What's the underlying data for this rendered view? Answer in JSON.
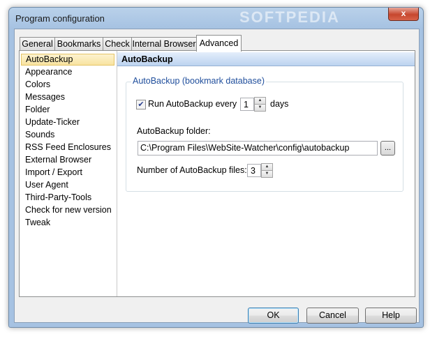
{
  "window": {
    "title": "Program configuration",
    "watermark": "SOFTPEDIA",
    "close_label": "x"
  },
  "tabs": [
    "General",
    "Bookmarks",
    "Check",
    "Internal Browser",
    "Advanced"
  ],
  "active_tab": "Advanced",
  "sidebar": {
    "items": [
      "AutoBackup",
      "Appearance",
      "Colors",
      "Messages",
      "Folder",
      "Update-Ticker",
      "Sounds",
      "RSS Feed Enclosures",
      "External Browser",
      "Import / Export",
      "User Agent",
      "Third-Party-Tools",
      "Check for new version",
      "Tweak"
    ],
    "selected": "AutoBackup"
  },
  "content": {
    "header": "AutoBackup",
    "group_title": "AutoBackup (bookmark database)",
    "run_label": "Run AutoBackup every",
    "run_checked": true,
    "interval_value": "1",
    "interval_unit": "days",
    "folder_label": "AutoBackup folder:",
    "folder_path": "C:\\Program Files\\WebSite-Watcher\\config\\autobackup",
    "browse_label": "...",
    "files_label": "Number of AutoBackup files:",
    "files_value": "3"
  },
  "buttons": {
    "ok": "OK",
    "cancel": "Cancel",
    "help": "Help"
  },
  "colors": {
    "accent_title": "#1f4e9c",
    "selection": "#f8e3a0"
  }
}
